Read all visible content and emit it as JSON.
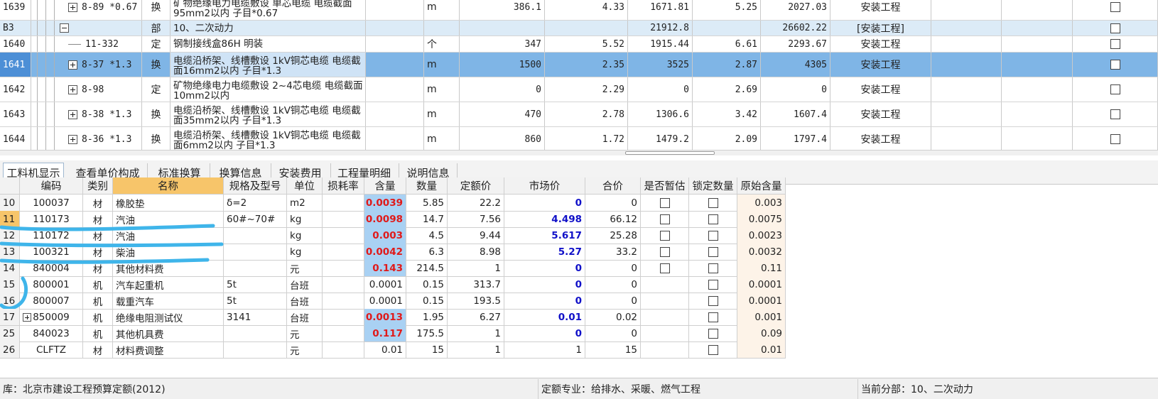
{
  "upper_rows": [
    {
      "row_no": "1639",
      "expander": "plus",
      "code": "8-89 *0.67",
      "type": "换",
      "name": "矿物绝缘电力电缆敷设 单芯电缆 电缆截面95mm2以内 子目*0.67",
      "unit": "m",
      "qty": "386.1",
      "price1": "4.33",
      "total1": "1671.81",
      "price2": "5.25",
      "total2": "2027.03",
      "category": "安装工程"
    },
    {
      "row_no": "B3",
      "expander": "minus",
      "code": "",
      "type": "部",
      "name": "10、二次动力",
      "unit": "",
      "qty": "",
      "price1": "",
      "total1": "21912.8",
      "price2": "",
      "total2": "26602.22",
      "category": "[安装工程]"
    },
    {
      "row_no": "1640",
      "expander": "line",
      "code": "11-332",
      "type": "定",
      "name": "钢制接线盒86H 明装",
      "unit": "个",
      "qty": "347",
      "price1": "5.52",
      "total1": "1915.44",
      "price2": "6.61",
      "total2": "2293.67",
      "category": "安装工程"
    },
    {
      "row_no": "1641",
      "expander": "plus",
      "code": "8-37 *1.3",
      "type": "换",
      "name": "电缆沿桥架、线槽敷设 1kV铜芯电缆 电缆截面16mm2以内 子目*1.3",
      "unit": "m",
      "qty": "1500",
      "price1": "2.35",
      "total1": "3525",
      "price2": "2.87",
      "total2": "4305",
      "category": "安装工程"
    },
    {
      "row_no": "1642",
      "expander": "plus",
      "code": "8-98",
      "type": "定",
      "name": "矿物绝缘电力电缆敷设 2~4芯电缆 电缆截面10mm2以内",
      "unit": "m",
      "qty": "0",
      "price1": "2.29",
      "total1": "0",
      "price2": "2.69",
      "total2": "0",
      "category": "安装工程"
    },
    {
      "row_no": "1643",
      "expander": "plus",
      "code": "8-38 *1.3",
      "type": "换",
      "name": "电缆沿桥架、线槽敷设 1kV铜芯电缆 电缆截面35mm2以内 子目*1.3",
      "unit": "m",
      "qty": "470",
      "price1": "2.78",
      "total1": "1306.6",
      "price2": "3.42",
      "total2": "1607.4",
      "category": "安装工程"
    },
    {
      "row_no": "1644",
      "expander": "plus",
      "code": "8-36 *1.3",
      "type": "换",
      "name": "电缆沿桥架、线槽敷设 1kV铜芯电缆 电缆截面6mm2以内 子目*1.3",
      "unit": "m",
      "qty": "860",
      "price1": "1.72",
      "total1": "1479.2",
      "price2": "2.09",
      "total2": "1797.4",
      "category": "安装工程"
    }
  ],
  "tabs": [
    "工料机显示",
    "查看单价构成",
    "标准换算",
    "换算信息",
    "安装费用",
    "工程量明细",
    "说明信息"
  ],
  "headers": [
    "",
    "编码",
    "类别",
    "名称",
    "规格及型号",
    "单位",
    "损耗率",
    "含量",
    "数量",
    "定额价",
    "市场价",
    "合价",
    "是否暂估",
    "锁定数量",
    "原始含量"
  ],
  "materials": [
    {
      "no": "10",
      "code": "100037",
      "cat": "材",
      "name": "橡胶垫",
      "spec": "δ=2",
      "unit": "m2",
      "loss": "",
      "content": "0.0039",
      "content_red": true,
      "qty": "5.85",
      "quota": "22.2",
      "market": "0",
      "market_blue": true,
      "total": "0",
      "est_box": true,
      "orig": "0.003"
    },
    {
      "no": "11",
      "code": "110173",
      "cat": "材",
      "name": "汽油",
      "spec": "60#~70#",
      "unit": "kg",
      "loss": "",
      "content": "0.0098",
      "content_red": true,
      "qty": "14.7",
      "quota": "7.56",
      "market": "4.498",
      "market_blue": true,
      "total": "66.12",
      "est_box": true,
      "orig": "0.0075"
    },
    {
      "no": "12",
      "code": "110172",
      "cat": "材",
      "name": "汽油",
      "spec": "",
      "unit": "kg",
      "loss": "",
      "content": "0.003",
      "content_red": true,
      "qty": "4.5",
      "quota": "9.44",
      "market": "5.617",
      "market_blue": true,
      "total": "25.28",
      "est_box": true,
      "orig": "0.0023"
    },
    {
      "no": "13",
      "code": "100321",
      "cat": "材",
      "name": "柴油",
      "spec": "",
      "unit": "kg",
      "loss": "",
      "content": "0.0042",
      "content_red": true,
      "qty": "6.3",
      "quota": "8.98",
      "market": "5.27",
      "market_blue": true,
      "total": "33.2",
      "est_box": true,
      "orig": "0.0032"
    },
    {
      "no": "14",
      "code": "840004",
      "cat": "材",
      "name": "其他材料费",
      "spec": "",
      "unit": "元",
      "loss": "",
      "content": "0.143",
      "content_red": true,
      "qty": "214.5",
      "quota": "1",
      "market": "0",
      "market_blue": true,
      "total": "0",
      "est_box": true,
      "orig": "0.11"
    },
    {
      "no": "15",
      "code": "800001",
      "cat": "机",
      "name": "汽车起重机",
      "spec": "5t",
      "unit": "台班",
      "loss": "",
      "content": "0.0001",
      "content_red": false,
      "qty": "0.15",
      "quota": "313.7",
      "market": "0",
      "market_blue": true,
      "total": "0",
      "est_box": false,
      "orig": "0.0001"
    },
    {
      "no": "16",
      "code": "800007",
      "cat": "机",
      "name": "载重汽车",
      "spec": "5t",
      "unit": "台班",
      "loss": "",
      "content": "0.0001",
      "content_red": false,
      "qty": "0.15",
      "quota": "193.5",
      "market": "0",
      "market_blue": true,
      "total": "0",
      "est_box": false,
      "orig": "0.0001"
    },
    {
      "no": "17",
      "code": "850009",
      "cat": "机",
      "name": "绝缘电阻测试仪",
      "spec": "3141",
      "unit": "台班",
      "loss": "",
      "content": "0.0013",
      "content_red": true,
      "qty": "1.95",
      "quota": "6.27",
      "market": "0.01",
      "market_blue": true,
      "total": "0.02",
      "est_box": false,
      "orig": "0.001",
      "expander": true
    },
    {
      "no": "25",
      "code": "840023",
      "cat": "机",
      "name": "其他机具费",
      "spec": "",
      "unit": "元",
      "loss": "",
      "content": "0.117",
      "content_red": true,
      "qty": "175.5",
      "quota": "1",
      "market": "0",
      "market_blue": true,
      "total": "0",
      "est_box": false,
      "orig": "0.09"
    },
    {
      "no": "26",
      "code": "CLFTZ",
      "cat": "材",
      "name": "材料费调整",
      "spec": "",
      "unit": "元",
      "loss": "",
      "content": "0.01",
      "content_red": false,
      "qty": "15",
      "quota": "1",
      "market": "1",
      "market_blue": false,
      "total": "15",
      "est_box": false,
      "orig": "0.01"
    }
  ],
  "status": {
    "left": "库：北京市建设工程预算定额(2012)",
    "middle": "定额专业：给排水、采暖、燃气工程",
    "right": "当前分部：10、二次动力"
  },
  "colors": {
    "selected_row": "#7fb5e6",
    "section_row": "#dcebf7",
    "content_cell": "#a9d1f3",
    "header_name": "#f7c56a",
    "annotation": "#3fb5ea"
  }
}
